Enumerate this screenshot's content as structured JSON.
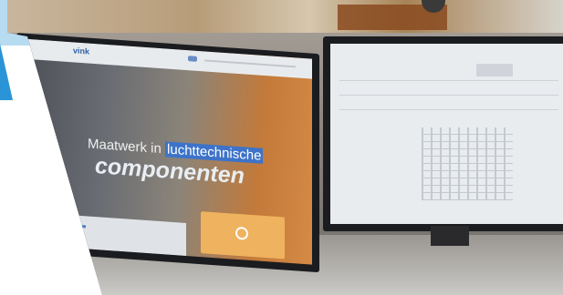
{
  "photo": {
    "left_screen": {
      "hero_line1_a": "Maatwerk in ",
      "hero_line1_b": "luchttechnische",
      "hero_line2": "componenten",
      "logo_text": "vink"
    }
  },
  "colors": {
    "accent_blue": "#2b94d6",
    "light_blue": "#b7dbf0",
    "site_blue": "#3d73c9"
  }
}
